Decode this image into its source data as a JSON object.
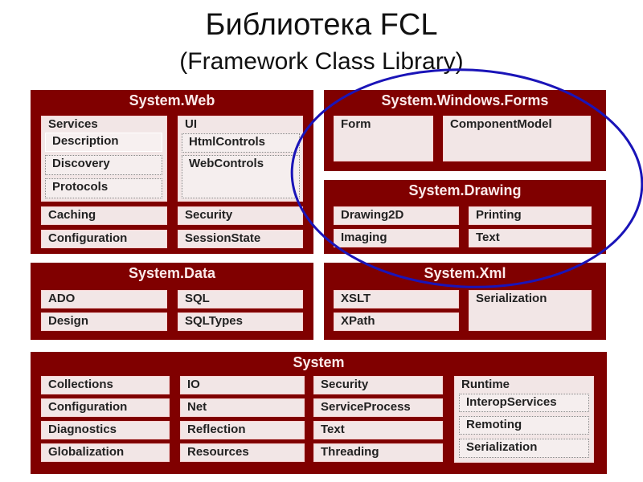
{
  "title": "Библиотека FCL",
  "subtitle": "(Framework Class Library)",
  "colors": {
    "namespace_bg": "#800000",
    "item_bg": "#f2e6e6",
    "highlight_ellipse": "#1a14b8"
  },
  "highlight": {
    "description": "Ellipse circling System.Windows.Forms and System.Drawing"
  },
  "web": {
    "title": "System.Web",
    "services": {
      "label": "Services",
      "items": [
        "Description",
        "Discovery",
        "Protocols"
      ]
    },
    "ui": {
      "label": "UI",
      "items": [
        "HtmlControls",
        "WebControls"
      ]
    },
    "caching": "Caching",
    "security": "Security",
    "configuration": "Configuration",
    "session_state": "SessionState"
  },
  "forms": {
    "title": "System.Windows.Forms",
    "items": [
      "Form",
      "ComponentModel"
    ]
  },
  "drawing": {
    "title": "System.Drawing",
    "items": [
      "Drawing2D",
      "Printing",
      "Imaging",
      "Text"
    ]
  },
  "data": {
    "title": "System.Data",
    "items": [
      "ADO",
      "SQL",
      "Design",
      "SQLTypes"
    ]
  },
  "xml": {
    "title": "System.Xml",
    "items": [
      "XSLT",
      "XPath",
      "Serialization"
    ]
  },
  "system": {
    "title": "System",
    "col1": [
      "Collections",
      "Configuration",
      "Diagnostics",
      "Globalization"
    ],
    "col2": [
      "IO",
      "Net",
      "Reflection",
      "Resources"
    ],
    "col3": [
      "Security",
      "ServiceProcess",
      "Text",
      "Threading"
    ],
    "runtime": {
      "label": "Runtime",
      "items": [
        "InteropServices",
        "Remoting",
        "Serialization"
      ]
    }
  }
}
